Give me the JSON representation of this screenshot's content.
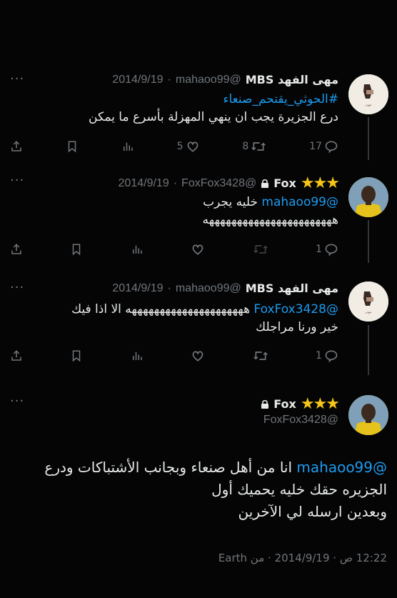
{
  "tweets": [
    {
      "name": "مهى الفهد MBS",
      "handle": "@mahaoo99",
      "date": "2014/9/19",
      "hashtag": "#الحوثي_يقتحم_صنعاء",
      "text": "درع الجزيرة يجب ان ينهي المهزلة بأسرع ما يمكن",
      "replies": "17",
      "retweets": "8",
      "likes": "5"
    },
    {
      "name": "Fox",
      "stars": "★★★",
      "handle": "@FoxFox3428",
      "date": "2014/9/19",
      "mention": "@mahaoo99",
      "text_line1": "خليه يجرب",
      "text_line2": "هههههههههههههههههههههههه",
      "replies": "1"
    },
    {
      "name": "مهى الفهد MBS",
      "handle": "@mahaoo99",
      "date": "2014/9/19",
      "mention": "@FoxFox3428",
      "text_line1": "هههههههههههههههههههههه الا اذا فيك",
      "text_line2": "خير ورنا مراجلك",
      "replies": "1"
    }
  ],
  "main_tweet": {
    "name": "Fox",
    "stars": "★★★",
    "handle": "@FoxFox3428",
    "mention": "@mahaoo99",
    "line1": "انا من أهل صنعاء وبجانب الأشتباكات ودرع",
    "line2": "الجزيره حقك خليه يحميك أول",
    "line3": "وبعدين ارسله لي الآخرين",
    "time": "12:22 ص",
    "date": "2014/9/19",
    "source": "من Earth"
  },
  "icons": [
    "share-icon",
    "bookmark-icon",
    "views-icon",
    "like-icon",
    "retweet-icon",
    "reply-icon",
    "lock-icon",
    "more-icon"
  ]
}
